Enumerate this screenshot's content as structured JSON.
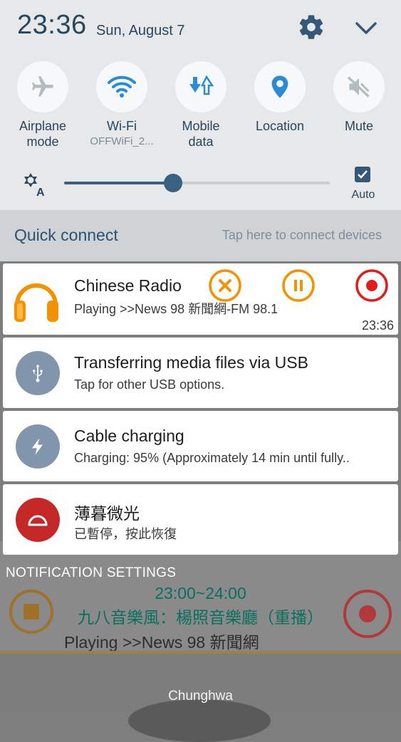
{
  "status": {
    "time": "23:36",
    "date": "Sun, August 7"
  },
  "quick_settings": {
    "tiles": [
      {
        "label": "Airplane\nmode",
        "sub": "",
        "icon": "airplane-icon"
      },
      {
        "label": "Wi-Fi",
        "sub": "OFFWiFi_2...",
        "icon": "wifi-icon"
      },
      {
        "label": "Mobile\ndata",
        "sub": "",
        "icon": "mobile-data-icon"
      },
      {
        "label": "Location",
        "sub": "",
        "icon": "location-icon"
      },
      {
        "label": "Mute",
        "sub": "",
        "icon": "mute-icon"
      }
    ],
    "brightness": {
      "level": 0.41,
      "auto_label": "Auto",
      "auto_checked": true
    }
  },
  "quick_connect": {
    "title": "Quick connect",
    "hint": "Tap here to connect devices"
  },
  "notifications": [
    {
      "title": "Chinese Radio",
      "text": "Playing >>News 98 新聞網-FM 98.1",
      "time": "23:36",
      "icon": "headphones-icon"
    },
    {
      "title": "Transferring media files via USB",
      "text": "Tap for other USB options.",
      "icon": "usb-icon"
    },
    {
      "title": "Cable charging",
      "text": "Charging: 95% (Approximately 14 min until fully..",
      "icon": "charging-icon"
    },
    {
      "title": "薄暮微光",
      "text": "已暫停，按此恢復",
      "icon": "twilight-icon"
    }
  ],
  "notification_settings": "NOTIFICATION SETTINGS",
  "background_app": {
    "time_range": "23:00~24:00",
    "program": "九八音樂風：楊照音樂廳（重播）",
    "playing": "Playing >>News 98 新聞網"
  },
  "carrier": "Chunghwa",
  "colors": {
    "accent": "#3a6182",
    "orange": "#f39200",
    "record_red": "#e21b1b",
    "twilight_red": "#c62828",
    "icon_blue_grey": "#8196ac"
  }
}
